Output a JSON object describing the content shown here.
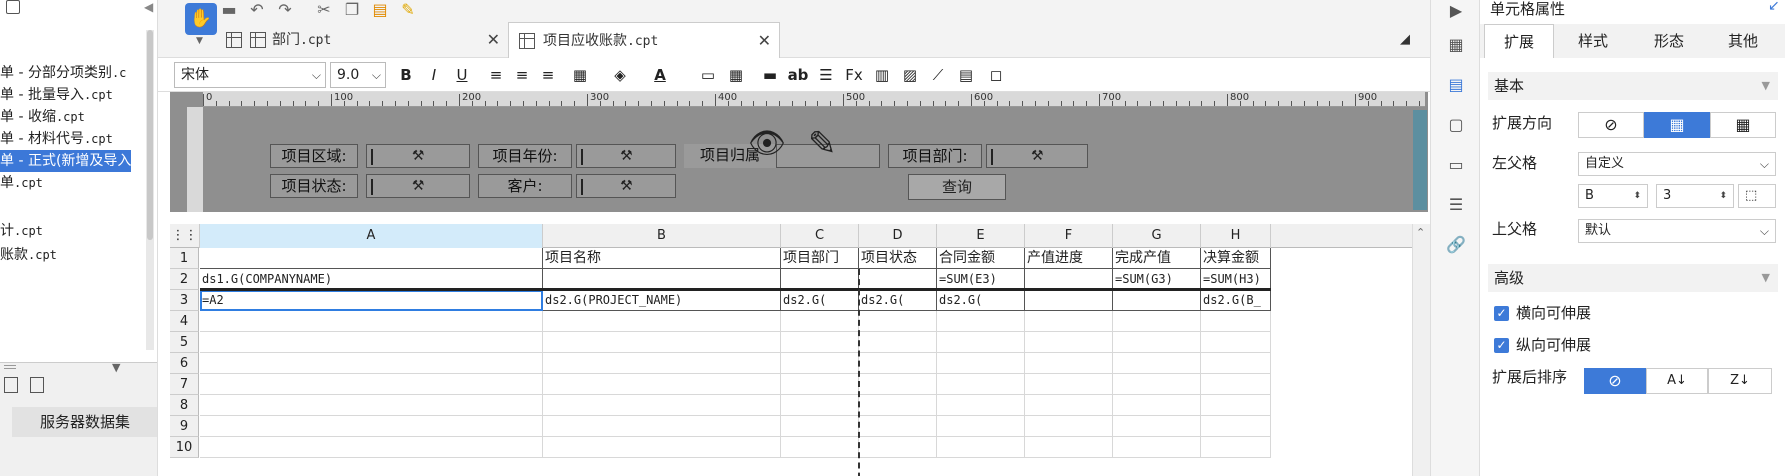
{
  "left_tree": {
    "items": [
      {
        "name": "单 - 分部分项类别",
        "ext": ".c",
        "selected": false
      },
      {
        "name": "单 - 批量导入",
        "ext": ".cpt",
        "selected": false
      },
      {
        "name": "单 - 收缩",
        "ext": ".cpt",
        "selected": false
      },
      {
        "name": "单 - 材料代号",
        "ext": ".cpt",
        "selected": false
      },
      {
        "name": "单 - 正式(新增及导入",
        "ext": "",
        "selected": true
      },
      {
        "name": "单",
        "ext": ".cpt",
        "selected": false
      },
      {
        "name": "计",
        "ext": ".cpt",
        "selected": false
      },
      {
        "name": "账款",
        "ext": ".cpt",
        "selected": false
      }
    ],
    "dataset_tab": "服务器数据集"
  },
  "doc_tabs": [
    {
      "name": "部门",
      "ext": ".cpt",
      "active": false
    },
    {
      "name": "项目应收账款",
      "ext": ".cpt",
      "active": true
    }
  ],
  "format_bar": {
    "font": "宋体",
    "size": "9.0",
    "bold": "B",
    "italic": "I",
    "underline": "U"
  },
  "ruler": [
    "0",
    "100",
    "200",
    "300",
    "400",
    "500",
    "600",
    "700",
    "800",
    "900"
  ],
  "param_panel": {
    "labels": {
      "area": "项目区域:",
      "year": "项目年份:",
      "owner": "项目归属",
      "dept": "项目部门:",
      "status": "项目状态:",
      "customer": "客户:"
    },
    "query_button": "查询"
  },
  "grid": {
    "columns": [
      "A",
      "B",
      "C",
      "D",
      "E",
      "F",
      "G",
      "H"
    ],
    "selected_column": "A",
    "rows": [
      "1",
      "2",
      "3",
      "4",
      "5",
      "6",
      "7",
      "8",
      "9",
      "10"
    ],
    "cells": {
      "B1": "项目名称",
      "C1": "项目部门",
      "D1": "项目状态",
      "E1": "合同金额",
      "F1": "产值进度",
      "G1": "完成产值",
      "H1": "决算金额",
      "A2": "ds1.G(COMPANYNAME)",
      "E2": "=SUM(E3)",
      "G2": "=SUM(G3)",
      "H2": "=SUM(H3)",
      "A3": "=A2",
      "B3": "ds2.G(PROJECT_NAME)",
      "C3": "ds2.G(",
      "D3": "ds2.G(",
      "E3": "ds2.G(",
      "H3": "ds2.G(B_"
    }
  },
  "right_panel": {
    "title": "单元格属性",
    "tabs": [
      "扩展",
      "样式",
      "形态",
      "其他"
    ],
    "active_tab": "扩展",
    "basic_section": "基本",
    "expand_direction_label": "扩展方向",
    "left_parent_label": "左父格",
    "left_parent_value": "自定义",
    "left_parent_col": "B",
    "left_parent_row": "3",
    "top_parent_label": "上父格",
    "top_parent_value": "默认",
    "advanced_section": "高级",
    "horizontal_extend": "横向可伸展",
    "vertical_extend": "纵向可伸展",
    "sort_label": "扩展后排序",
    "accent": "#3d7ad8"
  }
}
